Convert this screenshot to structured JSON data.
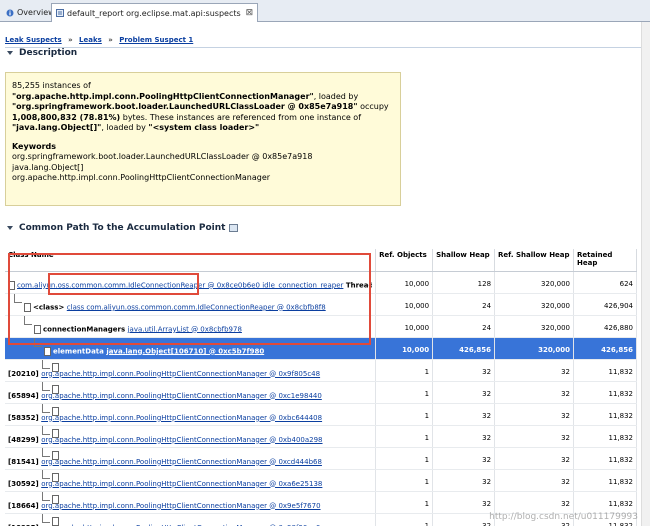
{
  "tabs": [
    {
      "label": "Overview",
      "active": false
    },
    {
      "label": "default_report  org.eclipse.mat.api:suspects",
      "active": true
    }
  ],
  "breadcrumb": {
    "items": [
      "Leak Suspects",
      "Leaks",
      "Problem Suspect 1"
    ],
    "separator": "»"
  },
  "sections": {
    "description": "Description",
    "common_path": "Common Path To the Accumulation Point"
  },
  "description": {
    "count_text": "85,255 instances of",
    "class_quoted": "\"org.apache.http.impl.conn.PoolingHttpClientConnectionManager\"",
    "loaded_by_text": ", loaded by",
    "loader_quoted": "\"org.springframework.boot.loader.LaunchedURLClassLoader @ 0x85e7a918\"",
    "occupy_prefix": "occupy ",
    "bytes_bold": "1,008,800,832 (78.81%)",
    "occupy_suffix": " bytes. These instances are referenced from one instance of ",
    "ref_class": "\"java.lang.Object[]\"",
    "loaded_by2": ", loaded by ",
    "system_loader": "\"<system class loader>\"",
    "keywords_title": "Keywords",
    "keywords": [
      "org.springframework.boot.loader.LaunchedURLClassLoader @ 0x85e7a918",
      "java.lang.Object[]",
      "org.apache.http.impl.conn.PoolingHttpClientConnectionManager"
    ]
  },
  "table": {
    "columns": [
      "Class Name",
      "Ref. Objects",
      "Shallow Heap",
      "Ref. Shallow Heap",
      "Retained Heap"
    ],
    "rows": [
      {
        "prefix": "",
        "link": "com.aliyun.oss.common.comm.IdleConnectionReaper @ 0x8ce0b6e0 idle_connection_reaper",
        "suffix": " Thread",
        "ref": "10,000",
        "shallow": "128",
        "ref_shallow": "320,000",
        "retained": "624",
        "selected": false
      },
      {
        "prefix": "<class> ",
        "link": "class com.aliyun.oss.common.comm.IdleConnectionReaper @ 0x8cbfb8f8",
        "suffix": "",
        "ref": "10,000",
        "shallow": "24",
        "ref_shallow": "320,000",
        "retained": "426,904",
        "selected": false
      },
      {
        "prefix": "connectionManagers ",
        "link": "java.util.ArrayList @ 0x8cbfb978",
        "suffix": "",
        "ref": "10,000",
        "shallow": "24",
        "ref_shallow": "320,000",
        "retained": "426,880",
        "selected": false
      },
      {
        "prefix": "elementData ",
        "link": "java.lang.Object[106710] @ 0xc5b7f980",
        "suffix": "",
        "ref": "10,000",
        "shallow": "426,856",
        "ref_shallow": "320,000",
        "retained": "426,856",
        "selected": true
      },
      {
        "prefix": "[20210] ",
        "link": "org.apache.http.impl.conn.PoolingHttpClientConnectionManager @ 0x9f805c48",
        "suffix": "",
        "ref": "1",
        "shallow": "32",
        "ref_shallow": "32",
        "retained": "11,832",
        "selected": false
      },
      {
        "prefix": "[65894] ",
        "link": "org.apache.http.impl.conn.PoolingHttpClientConnectionManager @ 0xc1e98440",
        "suffix": "",
        "ref": "1",
        "shallow": "32",
        "ref_shallow": "32",
        "retained": "11,832",
        "selected": false
      },
      {
        "prefix": "[58352] ",
        "link": "org.apache.http.impl.conn.PoolingHttpClientConnectionManager @ 0xbc644408",
        "suffix": "",
        "ref": "1",
        "shallow": "32",
        "ref_shallow": "32",
        "retained": "11,832",
        "selected": false
      },
      {
        "prefix": "[48299] ",
        "link": "org.apache.http.impl.conn.PoolingHttpClientConnectionManager @ 0xb400a298",
        "suffix": "",
        "ref": "1",
        "shallow": "32",
        "ref_shallow": "32",
        "retained": "11,832",
        "selected": false
      },
      {
        "prefix": "[81541] ",
        "link": "org.apache.http.impl.conn.PoolingHttpClientConnectionManager @ 0xcd444b68",
        "suffix": "",
        "ref": "1",
        "shallow": "32",
        "ref_shallow": "32",
        "retained": "11,832",
        "selected": false
      },
      {
        "prefix": "[30592] ",
        "link": "org.apache.http.impl.conn.PoolingHttpClientConnectionManager @ 0xa6e25138",
        "suffix": "",
        "ref": "1",
        "shallow": "32",
        "ref_shallow": "32",
        "retained": "11,832",
        "selected": false
      },
      {
        "prefix": "[18664] ",
        "link": "org.apache.http.impl.conn.PoolingHttpClientConnectionManager @ 0x9e5f7670",
        "suffix": "",
        "ref": "1",
        "shallow": "32",
        "ref_shallow": "32",
        "retained": "11,832",
        "selected": false
      },
      {
        "prefix": "[10995] ",
        "link": "org.apache.http.impl.conn.PoolingHttpClientConnectionManager @ 0x98f30aa0",
        "suffix": "",
        "ref": "1",
        "shallow": "32",
        "ref_shallow": "32",
        "retained": "11,832",
        "selected": false
      }
    ]
  },
  "watermark": "http://blog.csdn.net/u011179993",
  "colors": {
    "selection": "#3874d8",
    "highlight_box": "#e04a3a",
    "description_bg": "#fffbd9",
    "link": "#0b3fa0"
  }
}
